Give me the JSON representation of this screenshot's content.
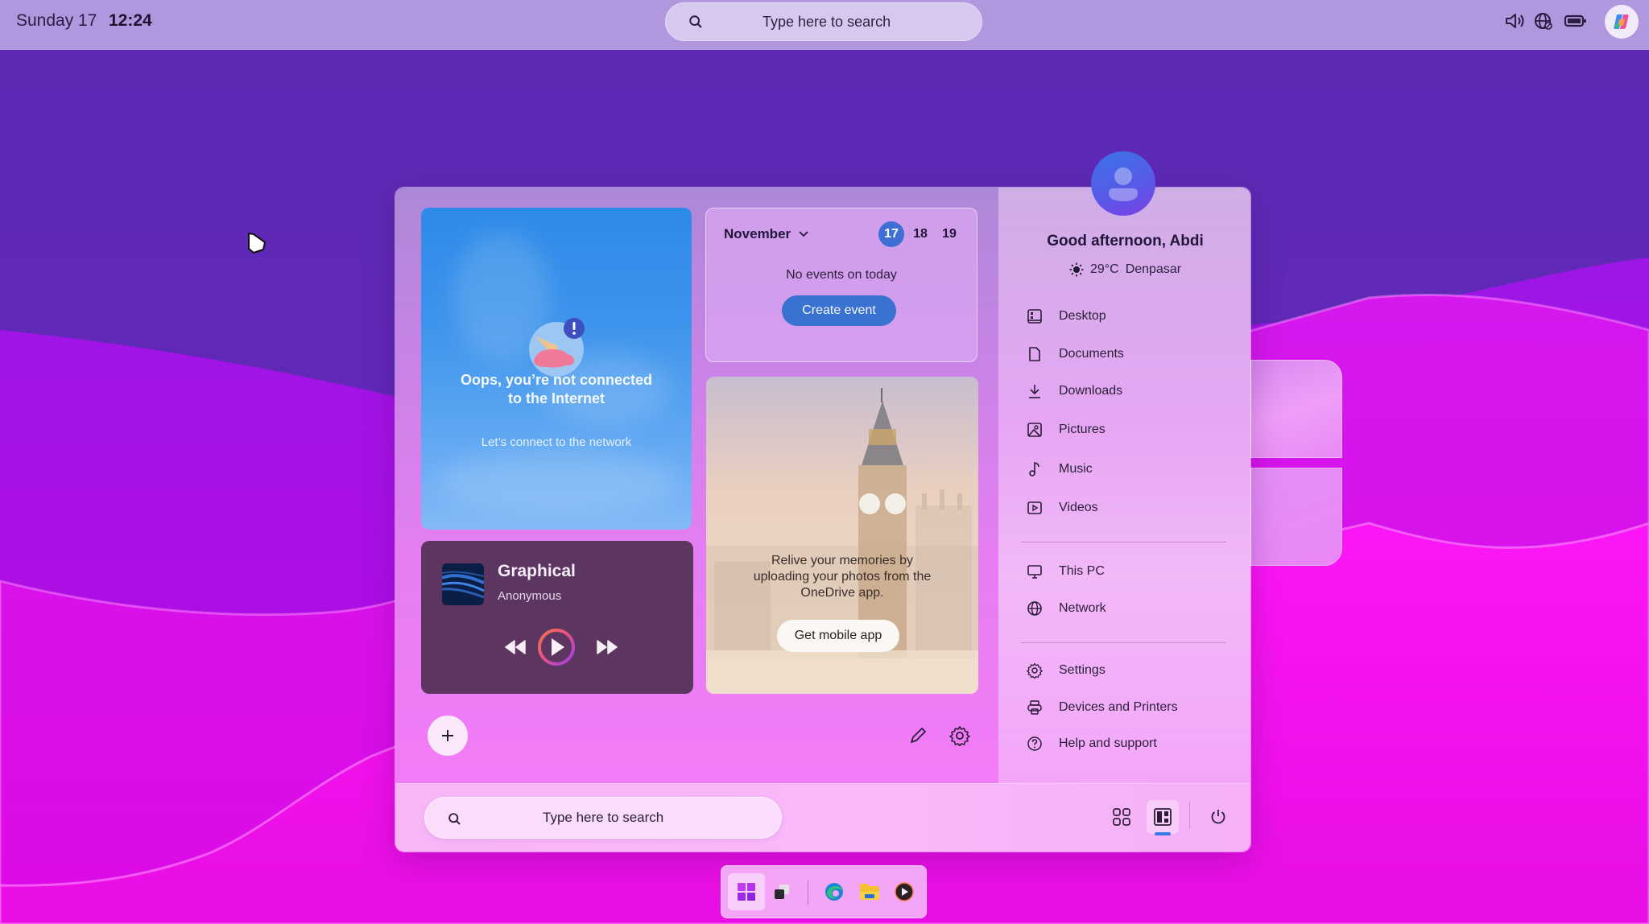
{
  "topbar": {
    "day": "Sunday 17",
    "time": "12:24",
    "search_placeholder": "Type here to search",
    "tray_icons": [
      "volume-icon",
      "globe-network-icon",
      "battery-icon",
      "copilot-icon"
    ]
  },
  "widgets": {
    "offline": {
      "title_line1": "Oops, you’re not connected",
      "title_line2": "to the Internet",
      "subtitle": "Let’s connect to the network"
    },
    "calendar": {
      "month": "November",
      "days": [
        {
          "label": "17",
          "today": true
        },
        {
          "label": "18",
          "today": false
        },
        {
          "label": "19",
          "today": false
        }
      ],
      "empty_text": "No events on today",
      "create_button": "Create event"
    },
    "music": {
      "track": "Graphical",
      "artist": "Anonymous"
    },
    "photos": {
      "message_line1": "Relive your memories by",
      "message_line2": "uploading your photos from the",
      "message_line3": "OneDrive app.",
      "button": "Get mobile app"
    }
  },
  "user": {
    "greeting": "Good afternoon, Abdi",
    "temperature": "29°C",
    "location": "Denpasar"
  },
  "menu": {
    "places": [
      {
        "label": "Desktop",
        "icon": "desktop-icon"
      },
      {
        "label": "Documents",
        "icon": "document-icon"
      },
      {
        "label": "Downloads",
        "icon": "download-icon"
      },
      {
        "label": "Pictures",
        "icon": "picture-icon"
      },
      {
        "label": "Music",
        "icon": "music-note-icon"
      },
      {
        "label": "Videos",
        "icon": "video-icon"
      }
    ],
    "system": [
      {
        "label": "This PC",
        "icon": "monitor-icon"
      },
      {
        "label": "Network",
        "icon": "globe-icon"
      }
    ],
    "settings": [
      {
        "label": "Settings",
        "icon": "gear-icon"
      },
      {
        "label": "Devices and Printers",
        "icon": "printer-icon"
      },
      {
        "label": "Help and support",
        "icon": "help-icon"
      }
    ]
  },
  "bottom": {
    "search_placeholder": "Type here to search"
  },
  "taskbar": {
    "items": [
      "start-icon",
      "task-view-icon",
      "edge-browser-icon",
      "file-explorer-icon",
      "media-player-icon"
    ]
  },
  "colors": {
    "accent_blue": "#3a72d2",
    "wallpaper_top": "#5e2ab4",
    "wallpaper_bottom": "#ff18f6"
  }
}
